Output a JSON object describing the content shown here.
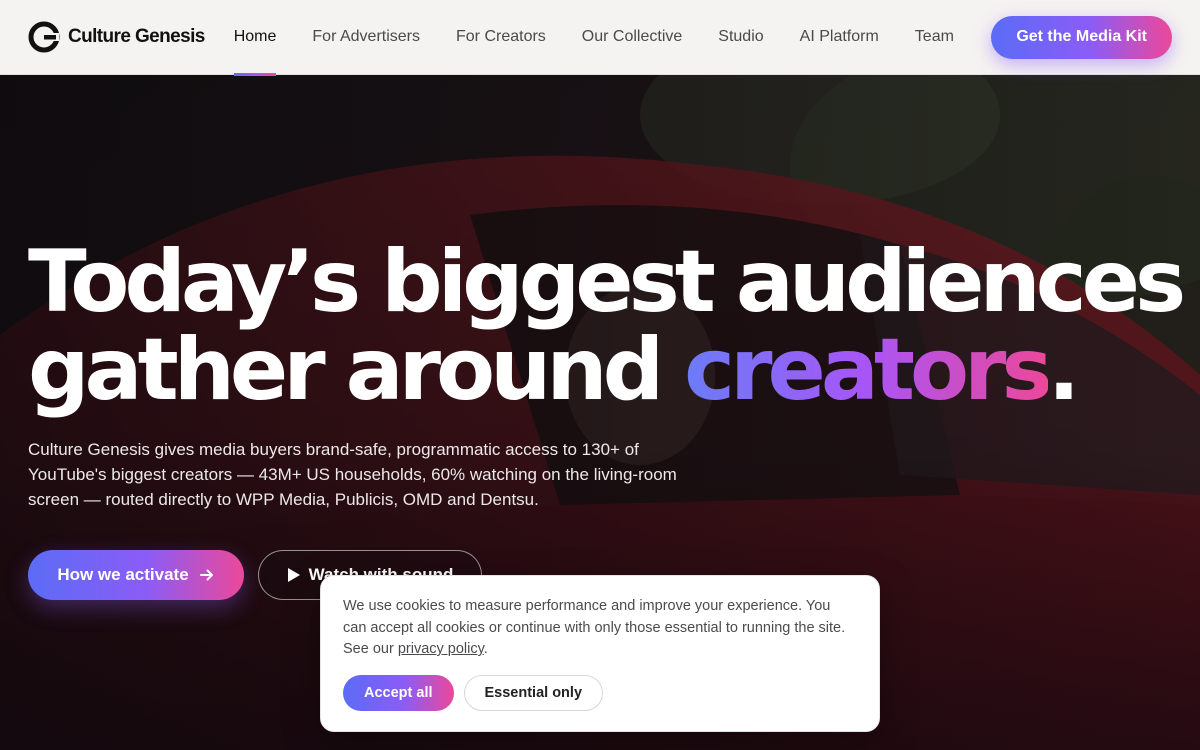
{
  "header": {
    "brand": "Culture Genesis",
    "nav": [
      {
        "label": "Home",
        "active": true
      },
      {
        "label": "For Advertisers",
        "active": false
      },
      {
        "label": "For Creators",
        "active": false
      },
      {
        "label": "Our Collective",
        "active": false
      },
      {
        "label": "Studio",
        "active": false
      },
      {
        "label": "AI Platform",
        "active": false
      },
      {
        "label": "Team",
        "active": false
      }
    ],
    "cta_label": "Get the Media Kit"
  },
  "hero": {
    "headline_line1": "Today’s biggest audiences",
    "headline_line2_prefix": "gather around",
    "headline_accent": "creators",
    "headline_suffix": ".",
    "subtext": "Culture Genesis gives media buyers brand-safe, programmatic access to 130+ of YouTube's biggest creators — 43M+ US households, 60% watching on the living-room screen — routed directly to WPP Media, Publicis, OMD and Dentsu.",
    "primary_button": "How we activate",
    "secondary_button": "Watch with sound"
  },
  "cookie_banner": {
    "text": "We use cookies to measure performance and improve your experience. You can accept all cookies or continue with only those essential to running the site. See our",
    "link_text": "privacy policy",
    "text_end": ".",
    "accept_label": "Accept all",
    "essential_label": "Essential only"
  },
  "colors": {
    "accent_start": "#5b6cf6",
    "accent_mid": "#8b5cf6",
    "accent_end": "#ec4899",
    "header_bg": "#f5f3f1"
  },
  "icons": {
    "logo": "culture-genesis-logo",
    "arrow": "arrow-right-icon",
    "play": "play-icon"
  }
}
